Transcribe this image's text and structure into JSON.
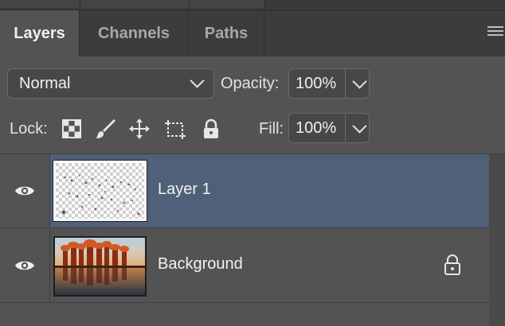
{
  "tabs": [
    {
      "label": "Layers",
      "active": true
    },
    {
      "label": "Channels",
      "active": false
    },
    {
      "label": "Paths",
      "active": false
    }
  ],
  "icons": {
    "panel_menu": "hamburger-menu-icon",
    "lock_transparent": "checkerboard-icon",
    "lock_image": "brush-icon",
    "lock_position": "move-arrows-icon",
    "lock_artboard": "crop-frame-icon",
    "lock_all": "padlock-icon",
    "visibility": "eye-icon"
  },
  "blend": {
    "mode": "Normal"
  },
  "opacity": {
    "label": "Opacity:",
    "value": "100%"
  },
  "lock": {
    "label": "Lock:"
  },
  "fill": {
    "label": "Fill:",
    "value": "100%"
  },
  "layers": [
    {
      "name": "Layer 1",
      "selected": true,
      "visible": true,
      "locked": false
    },
    {
      "name": "Background",
      "selected": false,
      "visible": true,
      "locked": true
    }
  ],
  "colors": {
    "panel_bg": "#535353",
    "tabbar_bg": "#3c3c3c",
    "selection": "#4f6078"
  }
}
